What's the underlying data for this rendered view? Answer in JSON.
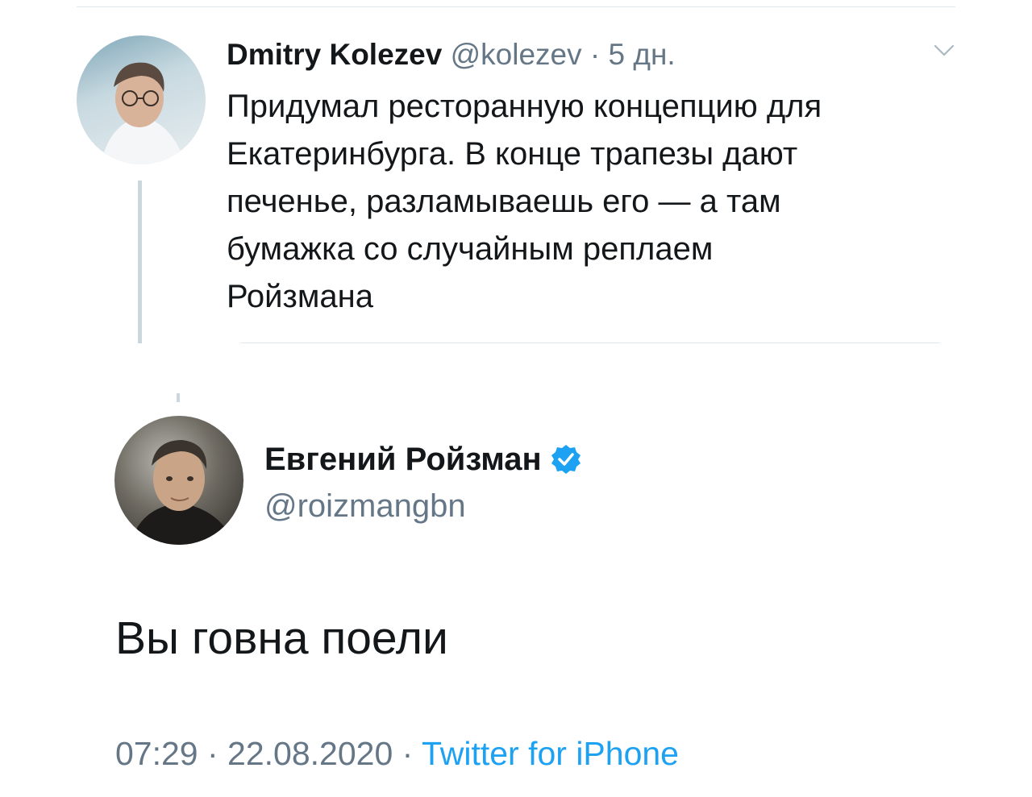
{
  "parent_tweet": {
    "display_name": "Dmitry Kolezev",
    "handle": "@kolezev",
    "separator": " · ",
    "time_ago": "5 дн.",
    "text_lines": [
      "Придумал ресторанную концепцию для",
      "Екатеринбурга. В конце трапезы дают",
      "печенье, разламываешь его — а там",
      "бумажка со случайным реплаем",
      "Ройзмана"
    ],
    "menu_icon": "chevron-down-icon"
  },
  "reply_tweet": {
    "display_name": "Евгений Ройзман",
    "verified_icon": "verified-badge-icon",
    "handle": "@roizmangbn",
    "text": "Вы говна поели",
    "time": "07:29",
    "separator": " · ",
    "date": "22.08.2020",
    "source": "Twitter for iPhone"
  },
  "colors": {
    "text_primary": "#14171a",
    "text_secondary": "#657786",
    "link": "#1da1f2",
    "verified": "#1da1f2",
    "divider": "#e1e8ed"
  }
}
